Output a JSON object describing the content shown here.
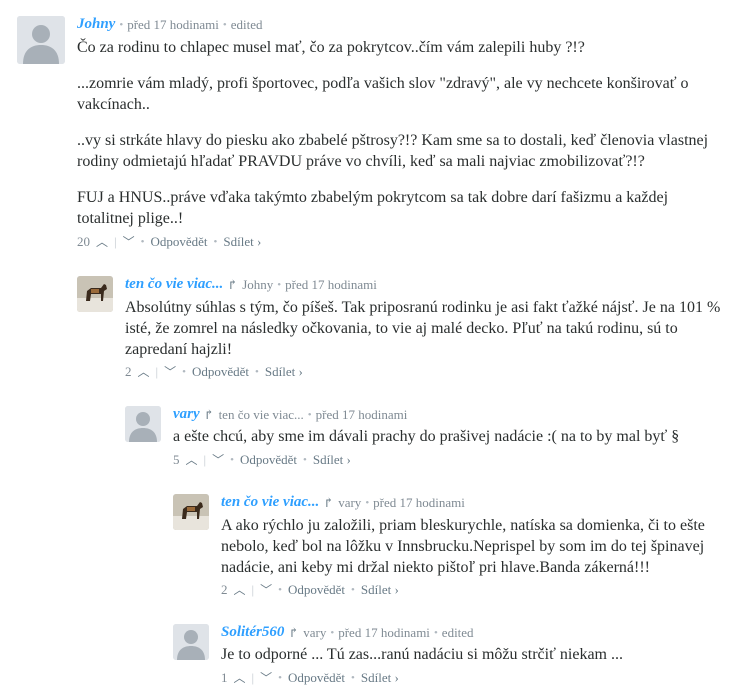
{
  "comments": [
    {
      "author": "Johny",
      "parent": "",
      "time": "před 17 hodinami",
      "edited": "edited",
      "body": [
        "Čo za rodinu to chlapec musel mať, čo za pokrytcov..čím vám zalepili huby ?!?",
        "...zomrie vám mladý, profi športovec, podľa vašich slov \"zdravý\", ale vy nechcete konširovať o vakcínach..",
        "..vy si strkáte hlavy do piesku ako zbabelé pštrosy?!? Kam sme sa to dostali, keď členovia vlastnej rodiny odmietajú hľadať PRAVDU práve vo chvíli, keď sa mali najviac zmobilizovať?!?",
        "FUJ a HNUS..práve vďaka takýmto zbabelým pokrytcom sa tak dobre darí fašizmu a každej totalitnej plige..!"
      ],
      "votes": "20",
      "reply": "Odpovědět",
      "share": "Sdílet ›",
      "avatar": "default"
    },
    {
      "author": "ten čo vie viac...",
      "parent": "Johny",
      "time": "před 17 hodinami",
      "edited": "",
      "body": [
        "Absolútny súhlas s tým, čo píšeš. Tak priposranú rodinku je asi fakt ťažké nájsť. Je na 101 % isté, že zomrel na následky očkovania, to vie aj malé decko. Pľuť na takú rodinu, sú to zapredaní hajzli!"
      ],
      "votes": "2",
      "reply": "Odpovědět",
      "share": "Sdílet ›",
      "avatar": "dog"
    },
    {
      "author": "vary",
      "parent": "ten čo vie viac...",
      "time": "před 17 hodinami",
      "edited": "",
      "body": [
        "a ešte chcú, aby sme im dávali prachy do prašivej nadácie :( na to by mal byť §"
      ],
      "votes": "5",
      "reply": "Odpovědět",
      "share": "Sdílet ›",
      "avatar": "default"
    },
    {
      "author": "ten čo vie viac...",
      "parent": "vary",
      "time": "před 17 hodinami",
      "edited": "",
      "body": [
        "A ako rýchlo ju založili, priam bleskurychle, natíska sa domienka, či to ešte nebolo, keď bol na lôžku v Innsbrucku.Neprispel by som im do tej špinavej nadácie, ani keby mi držal niekto pištoľ pri hlave.Banda zákerná!!!"
      ],
      "votes": "2",
      "reply": "Odpovědět",
      "share": "Sdílet ›",
      "avatar": "dog"
    },
    {
      "author": "Solitér560",
      "parent": "vary",
      "time": "před 17 hodinami",
      "edited": "edited",
      "body": [
        "Je to odporné ... Tú zas...ranú nadáciu si môžu strčiť niekam ..."
      ],
      "votes": "1",
      "reply": "Odpovědět",
      "share": "Sdílet ›",
      "avatar": "default"
    }
  ],
  "colors": {
    "author": "#2e9fff",
    "meta": "#7f8a93",
    "text": "#2a2e2e"
  }
}
